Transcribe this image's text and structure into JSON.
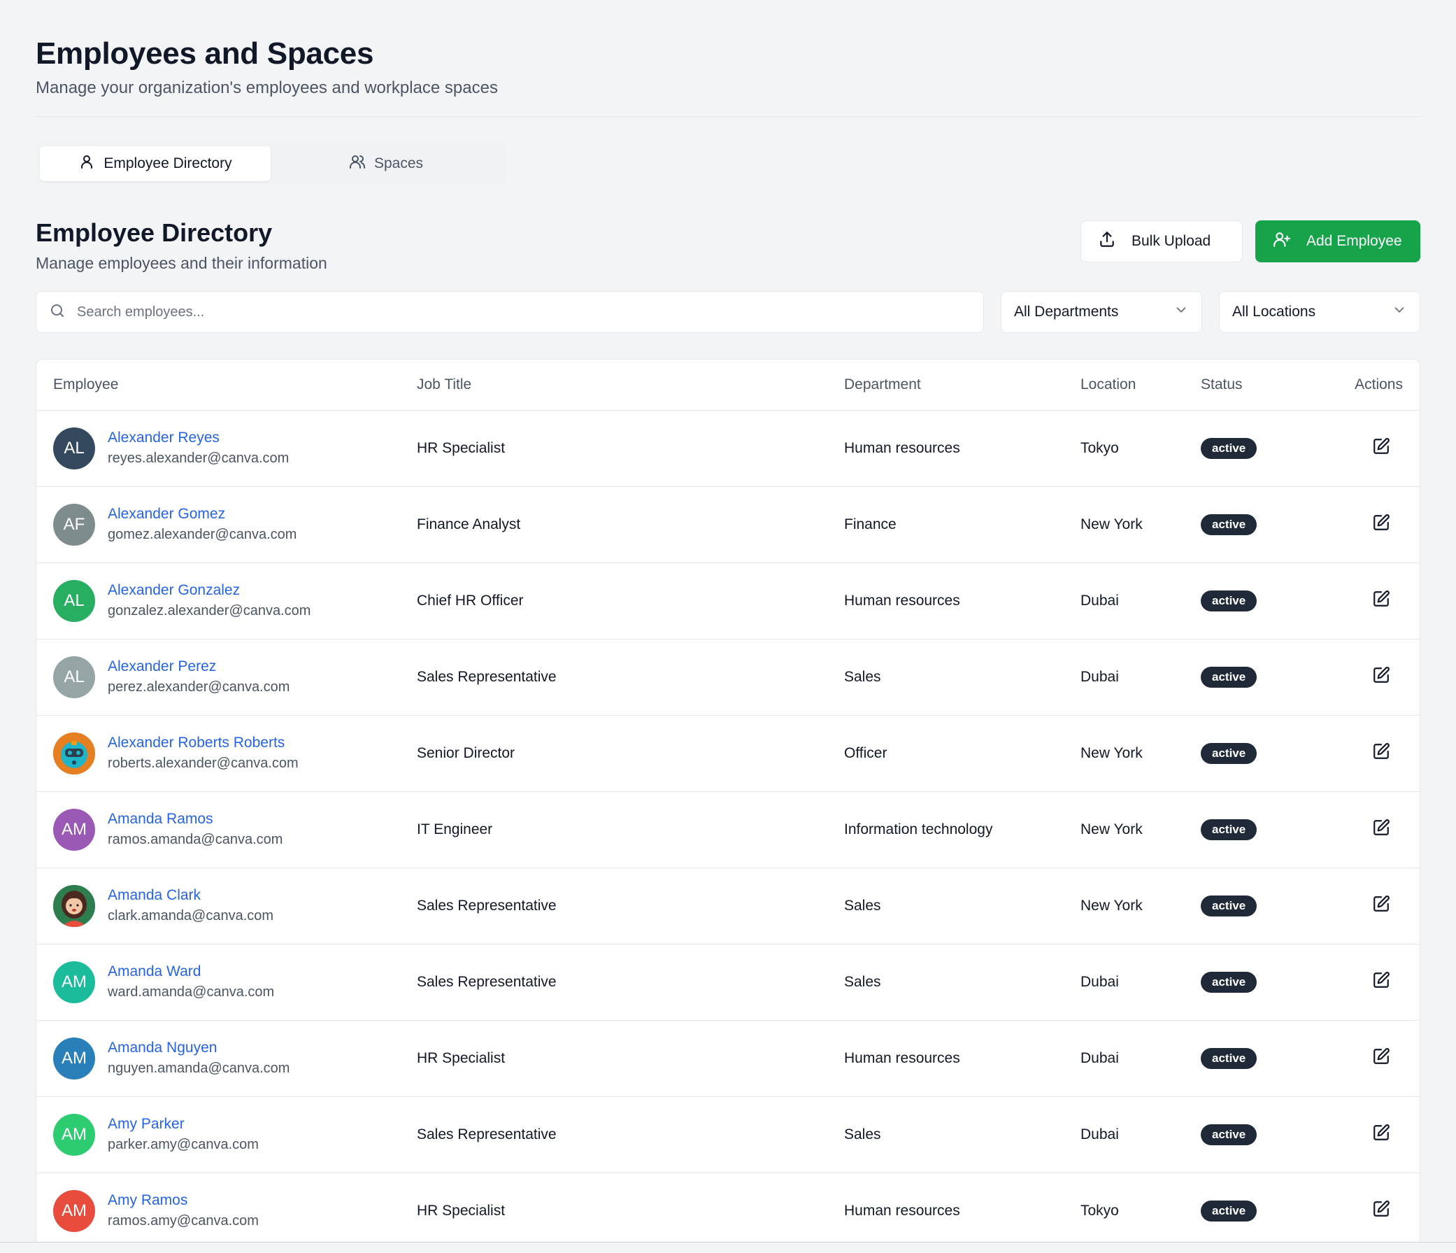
{
  "page": {
    "title": "Employees and Spaces",
    "subtitle": "Manage your organization's employees and workplace spaces"
  },
  "tabs": [
    {
      "label": "Employee Directory",
      "icon": "user-icon",
      "active": true
    },
    {
      "label": "Spaces",
      "icon": "users-icon",
      "active": false
    }
  ],
  "section": {
    "title": "Employee Directory",
    "subtitle": "Manage employees and their information"
  },
  "toolbar": {
    "bulk_upload_label": "Bulk Upload",
    "add_employee_label": "Add Employee"
  },
  "filters": {
    "search_placeholder": "Search employees...",
    "department": "All Departments",
    "location": "All Locations"
  },
  "table": {
    "headers": {
      "employee": "Employee",
      "job_title": "Job Title",
      "department": "Department",
      "location": "Location",
      "status": "Status",
      "actions": "Actions"
    },
    "rows": [
      {
        "initials": "AL",
        "avatar_color": "#34495e",
        "name": "Alexander Reyes",
        "email": "reyes.alexander@canva.com",
        "job": "HR Specialist",
        "dept": "Human resources",
        "loc": "Tokyo",
        "status": "active"
      },
      {
        "initials": "AF",
        "avatar_color": "#7f8c8d",
        "name": "Alexander Gomez",
        "email": "gomez.alexander@canva.com",
        "job": "Finance Analyst",
        "dept": "Finance",
        "loc": "New York",
        "status": "active"
      },
      {
        "initials": "AL",
        "avatar_color": "#27ae60",
        "name": "Alexander Gonzalez",
        "email": "gonzalez.alexander@canva.com",
        "job": "Chief HR Officer",
        "dept": "Human resources",
        "loc": "Dubai",
        "status": "active"
      },
      {
        "initials": "AL",
        "avatar_color": "#95a5a6",
        "name": "Alexander Perez",
        "email": "perez.alexander@canva.com",
        "job": "Sales Representative",
        "dept": "Sales",
        "loc": "Dubai",
        "status": "active"
      },
      {
        "initials": "",
        "avatar_color": "#e67e22",
        "avatar_image": "robot-avatar",
        "name": "Alexander Roberts Roberts",
        "email": "roberts.alexander@canva.com",
        "job": "Senior Director",
        "dept": "Officer",
        "loc": "New York",
        "status": "active"
      },
      {
        "initials": "AM",
        "avatar_color": "#9b59b6",
        "name": "Amanda Ramos",
        "email": "ramos.amanda@canva.com",
        "job": "IT Engineer",
        "dept": "Information technology",
        "loc": "New York",
        "status": "active"
      },
      {
        "initials": "",
        "avatar_color": "#2e7d4f",
        "avatar_image": "woman-avatar",
        "name": "Amanda Clark",
        "email": "clark.amanda@canva.com",
        "job": "Sales Representative",
        "dept": "Sales",
        "loc": "New York",
        "status": "active"
      },
      {
        "initials": "AM",
        "avatar_color": "#1abc9c",
        "name": "Amanda Ward",
        "email": "ward.amanda@canva.com",
        "job": "Sales Representative",
        "dept": "Sales",
        "loc": "Dubai",
        "status": "active"
      },
      {
        "initials": "AM",
        "avatar_color": "#2980b9",
        "name": "Amanda Nguyen",
        "email": "nguyen.amanda@canva.com",
        "job": "HR Specialist",
        "dept": "Human resources",
        "loc": "Dubai",
        "status": "active"
      },
      {
        "initials": "AM",
        "avatar_color": "#2ecc71",
        "name": "Amy Parker",
        "email": "parker.amy@canva.com",
        "job": "Sales Representative",
        "dept": "Sales",
        "loc": "Dubai",
        "status": "active"
      },
      {
        "initials": "AM",
        "avatar_color": "#e74c3c",
        "name": "Amy Ramos",
        "email": "ramos.amy@canva.com",
        "job": "HR Specialist",
        "dept": "Human resources",
        "loc": "Tokyo",
        "status": "active"
      }
    ]
  },
  "colors": {
    "accent": "#16a34a",
    "link": "#2563eb",
    "badge": "#1f2937"
  }
}
